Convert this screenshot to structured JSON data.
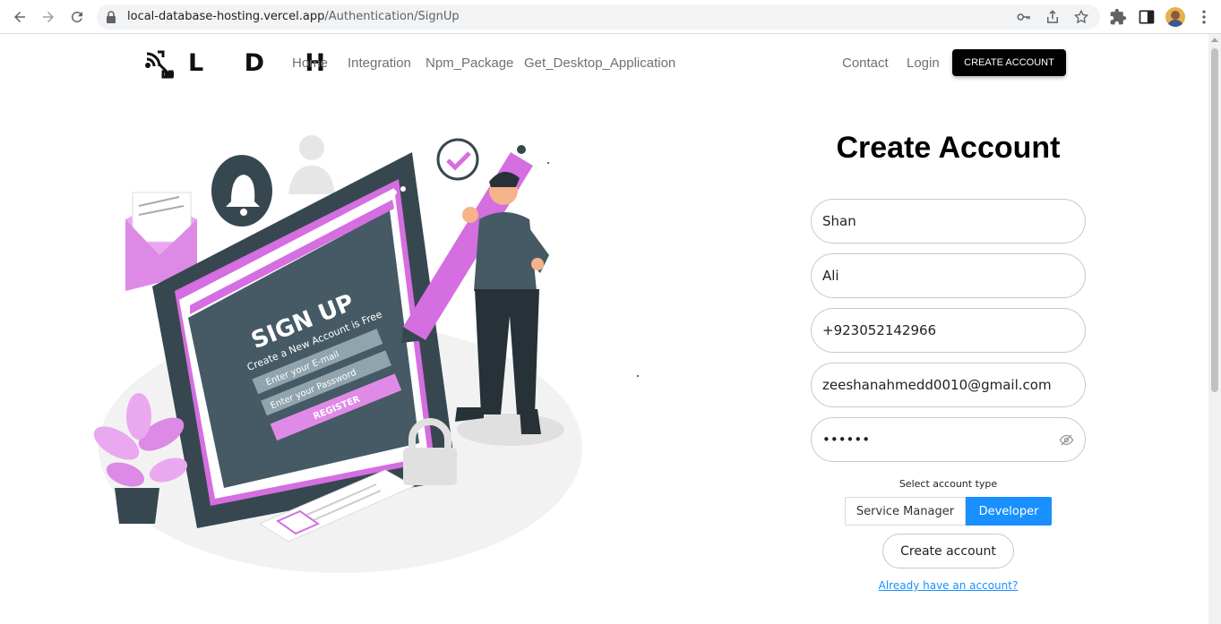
{
  "browser": {
    "url_host": "local-database-hosting.vercel.app",
    "url_path": "/Authentication/SignUp"
  },
  "site": {
    "logo_text": "L D H",
    "nav": [
      {
        "label": "Home"
      },
      {
        "label": "Integration"
      },
      {
        "label": "Npm_Package"
      },
      {
        "label": "Get_Desktop_Application"
      }
    ],
    "contact_label": "Contact",
    "login_label": "Login",
    "create_account_top": "CREATE ACCOUNT"
  },
  "illustration": {
    "title": "SIGN UP",
    "subtitle": "Create a New Account is Free",
    "email_placeholder": "Enter your E-mail",
    "password_placeholder": "Enter your Password",
    "register": "REGISTER"
  },
  "form": {
    "title": "Create Account",
    "first_name": "Shan",
    "last_name": "Ali",
    "phone": "+923052142966",
    "email": "zeeshanahmedd0010@gmail.com",
    "password_mask": "••••••",
    "account_type_label": "Select account type",
    "account_types": [
      "Service Manager",
      "Developer"
    ],
    "selected_account_type": "Developer",
    "submit_label": "Create account",
    "login_link": "Already have an account?"
  },
  "colors": {
    "accent": "#1890ff",
    "illustration_pink": "#d56ee0",
    "illustration_dark": "#37474f"
  }
}
